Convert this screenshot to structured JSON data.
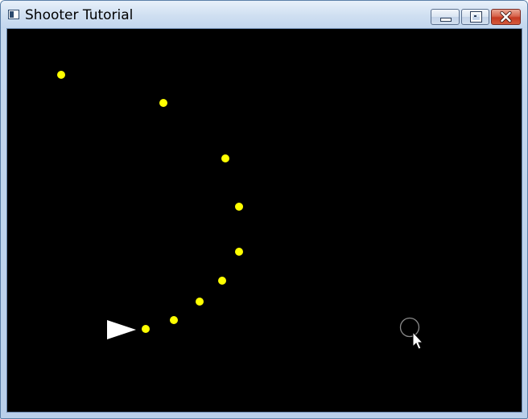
{
  "window": {
    "title": "Shooter Tutorial",
    "icon": "app-window-icon",
    "controls": {
      "minimize_icon": "minimize-icon",
      "maximize_icon": "maximize-icon",
      "close_icon": "close-icon"
    }
  },
  "game": {
    "background_color": "#000000",
    "bullet_color": "#ffff00",
    "player_color": "#ffffff",
    "reticle_color": "#8a8a8a",
    "player_icon": "player-ship",
    "reticle_icon": "aim-reticle",
    "cursor_icon": "mouse-pointer-icon"
  }
}
